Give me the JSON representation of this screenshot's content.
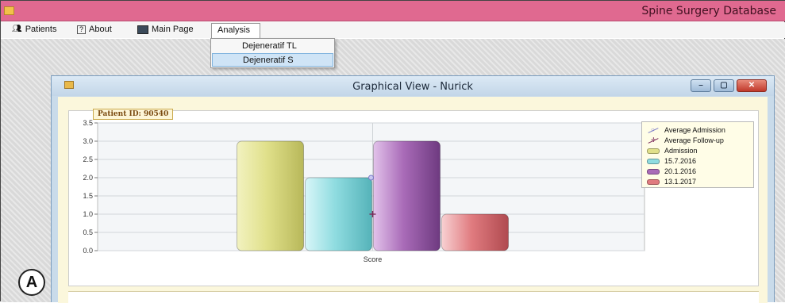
{
  "window": {
    "title": "Spine Surgery Database"
  },
  "menu": {
    "patients": "Patients",
    "about": "About",
    "main_page": "Main Page",
    "analysis": "Analysis",
    "about_icon": "?"
  },
  "analysis_menu": {
    "items": [
      "Dejeneratif TL",
      "Dejeneratif S"
    ],
    "selected_index": 1
  },
  "child_window": {
    "title": "Graphical View - Nurick"
  },
  "patient_label": "Patient ID: 90540",
  "figure_label": "A",
  "colors": {
    "titlebar": "#e06990",
    "admission": "#e0e08a",
    "d_15_7_2016": "#8fdce0",
    "d_20_1_2016": "#a96bb8",
    "d_13_1_2017": "#e07b7f",
    "avg_admission": "#7a7ac8",
    "avg_followup": "#7a2a5a"
  },
  "chart_data": {
    "type": "bar",
    "categories": [
      "Score"
    ],
    "ylim": [
      0,
      3.5
    ],
    "yticks": [
      "0.0",
      "0.5",
      "1.0",
      "1.5",
      "2.0",
      "2.5",
      "3.0",
      "3.5"
    ],
    "series": [
      {
        "name": "Admission",
        "values": [
          3.0
        ]
      },
      {
        "name": "15.7.2016",
        "values": [
          2.0
        ]
      },
      {
        "name": "20.1.2016",
        "values": [
          3.0
        ]
      },
      {
        "name": "13.1.2017",
        "values": [
          1.0
        ]
      }
    ],
    "lines": [
      {
        "name": "Average Admission",
        "values": [
          2.0
        ]
      },
      {
        "name": "Average Follow-up",
        "values": [
          1.0
        ]
      }
    ],
    "legend_position": "top-right",
    "grid": true
  }
}
